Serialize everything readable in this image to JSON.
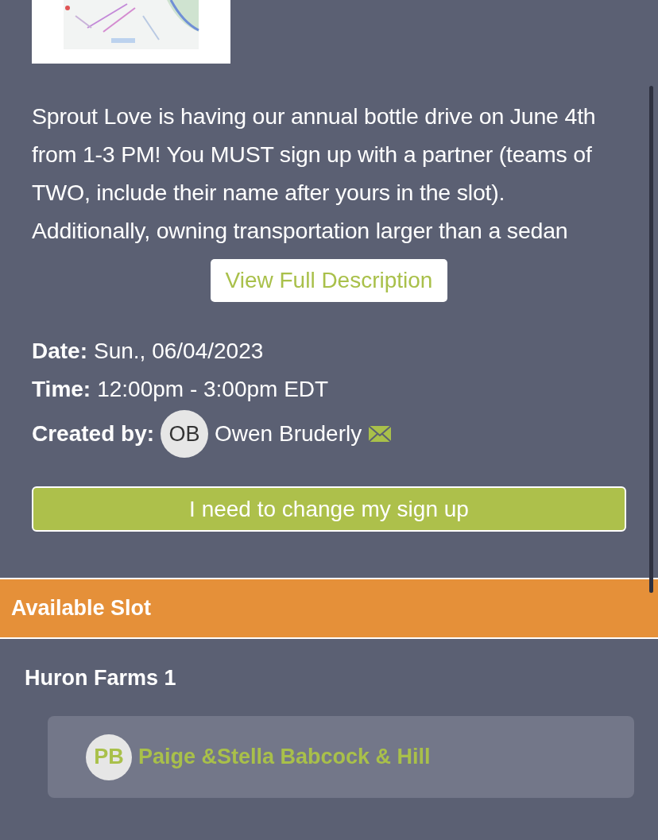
{
  "description": "Sprout Love is having our annual bottle drive on June 4th from 1-3 PM! You MUST sign up with a partner (teams of TWO, include their name after yours in the slot). Additionally, owning transportation larger than a sedan",
  "view_full_button": "View Full Description",
  "details": [
    {
      "label": "Date:",
      "value": "Sun., 06/04/2023"
    },
    {
      "label": "Time:",
      "value": "12:00pm - 3:00pm EDT"
    }
  ],
  "created_by": {
    "label": "Created by:",
    "initials": "OB",
    "name": "Owen Bruderly"
  },
  "change_signup_button": "I need to change my sign up",
  "section": {
    "title": "Available Slot",
    "slots": [
      {
        "title": "Huron Farms 1",
        "signups": [
          {
            "initials": "PB",
            "name": "Paige &Stella Babcock & Hill"
          }
        ]
      }
    ]
  }
}
